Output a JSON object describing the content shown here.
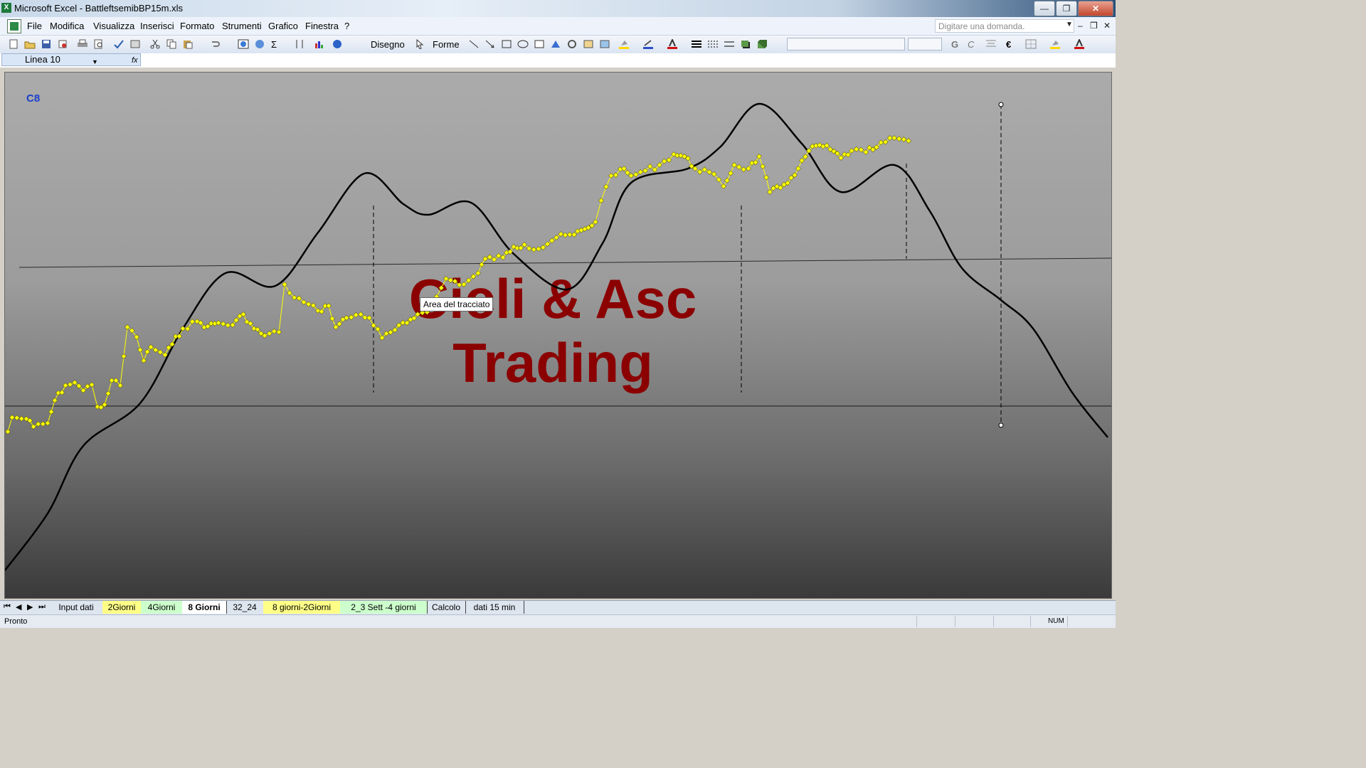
{
  "window": {
    "title": "Microsoft Excel - BattleftsemibBP15m.xls",
    "app_icon": "excel-icon",
    "controls": {
      "minimize": "—",
      "restore": "❒",
      "close": "✕"
    }
  },
  "menubar": {
    "items": [
      {
        "label": "File"
      },
      {
        "label": "Modifica"
      },
      {
        "label": "Visualizza"
      },
      {
        "label": "Inserisci"
      },
      {
        "label": "Formato"
      },
      {
        "label": "Strumenti"
      },
      {
        "label": "Grafico"
      },
      {
        "label": "Finestra"
      },
      {
        "label": "?"
      }
    ],
    "ask_placeholder": "Digitare una domanda.",
    "mdi_controls": {
      "minimize": "–",
      "restore": "❒",
      "close": "✕"
    }
  },
  "toolbar": {
    "draw_label": "Disegno",
    "shapes_label": "Forme",
    "bold_label": "G",
    "italic_label": "C",
    "euro_label": "€"
  },
  "formula_bar": {
    "name_box": "Linea 10",
    "fx_label": "fx"
  },
  "chart": {
    "corner_label": "C8",
    "watermark_line1": "Cicli & Asc",
    "watermark_line2": "Trading",
    "tooltip": "Area del tracciato",
    "colors": {
      "price": "#ffff00",
      "cycle": "#000000",
      "watermark": "#8b0000",
      "corner_label": "#1a3ecc"
    }
  },
  "sheet_tabs": [
    {
      "label": "Input dati",
      "style": "plain"
    },
    {
      "label": "2Giorni",
      "style": "yellow"
    },
    {
      "label": "4Giorni",
      "style": "green"
    },
    {
      "label": "8 Giorni",
      "style": "active"
    },
    {
      "label": "32_24",
      "style": "plain"
    },
    {
      "label": "8 giorni-2Giorni",
      "style": "yellow"
    },
    {
      "label": "2_3 Sett -4 giorni",
      "style": "green"
    },
    {
      "label": "Calcolo",
      "style": "plain"
    },
    {
      "label": "dati 15 min",
      "style": "plain"
    }
  ],
  "status": {
    "text": "Pronto",
    "num": "NUM"
  }
}
